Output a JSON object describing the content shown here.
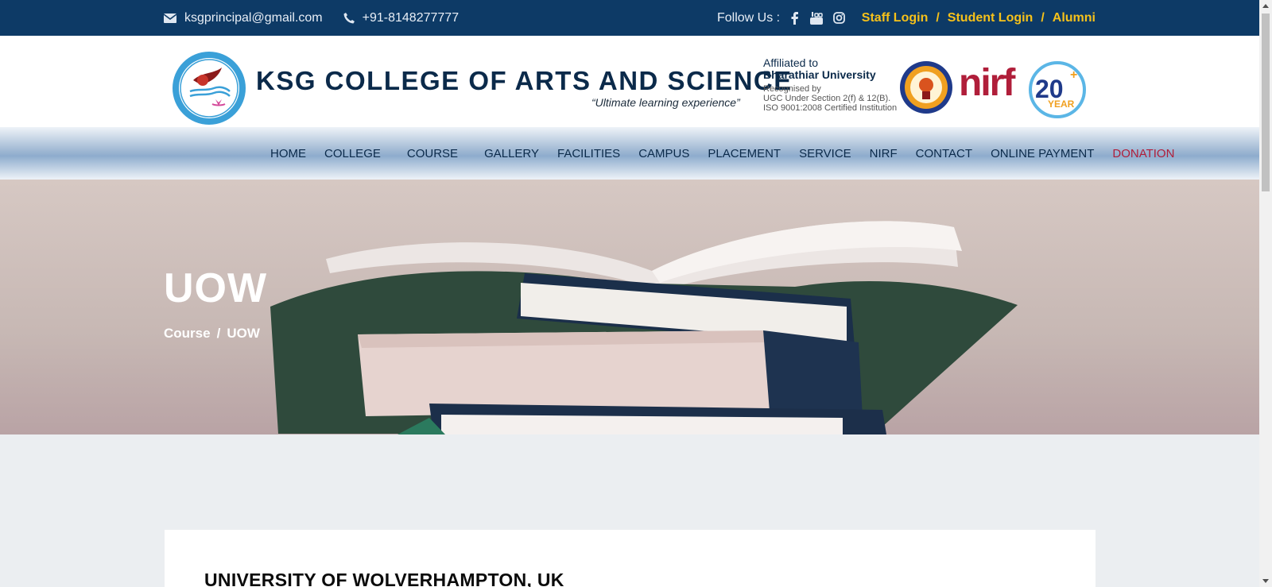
{
  "topbar": {
    "email": "ksgprincipal@gmail.com",
    "phone": "+91-8148277777",
    "follow_label": "Follow Us :",
    "social_icons": [
      "facebook-icon",
      "youtube-icon",
      "instagram-icon"
    ],
    "logins": [
      "Staff Login",
      "Student Login",
      "Alumni"
    ],
    "separator": "/"
  },
  "header": {
    "college_name": "KSG COLLEGE  OF ARTS AND SCIENCE",
    "tagline": "“Ultimate learning experience”",
    "affiliation": {
      "line1": "Affiliated to",
      "line2": "Bharathiar University",
      "line3": "Recognised by",
      "line4": "UGC Under Section 2(f) & 12(B).",
      "line5": "ISO 9001:2008 Certified Institution"
    },
    "nirf_logo_text": "nirf",
    "years_badge": "20",
    "years_badge_sub": "YEAR",
    "years_badge_plus": "+"
  },
  "nav": {
    "items": [
      "HOME",
      "COLLEGE",
      "COURSE",
      "GALLERY",
      "FACILITIES",
      "CAMPUS",
      "PLACEMENT",
      "SERVICE",
      "NIRF",
      "CONTACT",
      "ONLINE PAYMENT",
      "DONATION"
    ]
  },
  "hero": {
    "title": "UOW",
    "breadcrumb": [
      "Course",
      "UOW"
    ],
    "breadcrumb_separator": "/"
  },
  "content": {
    "heading": "UNIVERSITY OF WOLVERHAMPTON, UK"
  },
  "colors": {
    "topbar_bg": "#0d3a66",
    "login_accent": "#f6c11a",
    "nav_text": "#0b2a4a",
    "donation": "#b01e3a",
    "page_bg": "#ebeef1"
  }
}
